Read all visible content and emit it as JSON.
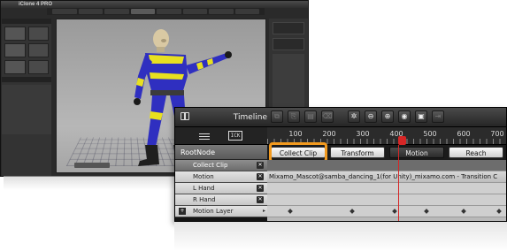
{
  "app": {
    "logo": "iClone 4 PRO",
    "tabs": [
      "",
      "",
      "",
      "",
      "",
      "",
      "",
      ""
    ],
    "viewport_button": ""
  },
  "timeline": {
    "title": "Timeline",
    "ruler_labels": [
      "100",
      "200",
      "300",
      "400",
      "500",
      "600",
      "700"
    ],
    "root_node": "RootNode",
    "track_buttons": [
      "Collect Clip",
      "Transform",
      "Motion",
      "Reach"
    ],
    "tracks": [
      {
        "label": "Collect Clip"
      },
      {
        "label": "Motion"
      },
      {
        "label": "L Hand"
      },
      {
        "label": "R Hand"
      },
      {
        "label": "Motion Layer"
      }
    ],
    "motion_clip": "Mixamo_Mascot@samba_dancing_1(for Unity)_mixamo.com - Transition C",
    "keyframe_icon_text": "ICK",
    "close_glyph": "✕",
    "expand_glyph": "+"
  },
  "colors": {
    "highlight": "#f29a1f",
    "playhead": "#d62626",
    "suit_yellow": "#e8e020",
    "suit_blue": "#2f2fc0"
  }
}
